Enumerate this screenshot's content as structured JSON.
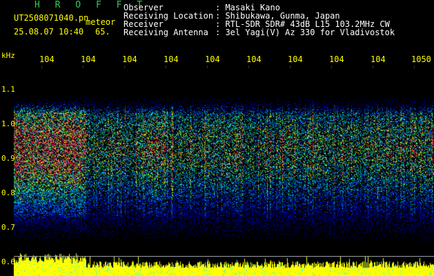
{
  "header": {
    "title": "H R O F F T",
    "filename": "UT2508071040.pn",
    "file_suffix": "meteor",
    "date_time": "25.08.07 10:40",
    "extra": "65.",
    "fields": [
      {
        "label": "Observer",
        "value": ": Masaki Kano"
      },
      {
        "label": "Receiving Location",
        "value": ": Shibukawa, Gunma, Japan"
      },
      {
        "label": "Receiver",
        "value": ": RTL-SDR SDR# 43dB L15 103.2MHz CW"
      },
      {
        "label": "Receiving Antenna",
        "value": ": 3el Yagi(V) Az 330 for Vladivostok"
      }
    ]
  },
  "axis": {
    "y_unit": "kHz",
    "y_ticks": [
      "1.1",
      "1.0",
      "0.9",
      "0.8",
      "0.7",
      "0.6"
    ],
    "x_ticks": [
      "104",
      "104",
      "104",
      "104",
      "104",
      "104",
      "104",
      "104",
      "104",
      "1050"
    ]
  },
  "colors": {
    "background": "#000000",
    "tick_text": "#ffff00",
    "title_green": "#2fd04a",
    "power_bar": "#ffff00"
  }
}
